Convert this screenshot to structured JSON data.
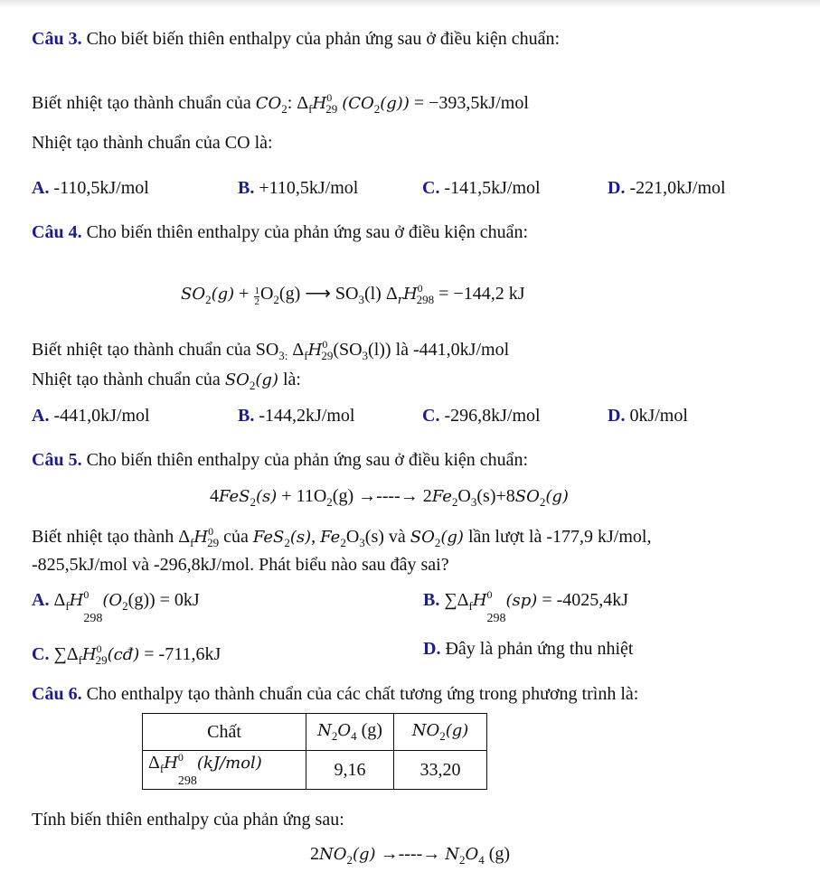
{
  "accent_color": "#1c1c8c",
  "q3": {
    "intro": [
      {
        "t": "Câu 3.",
        "s": "b"
      },
      " Cho biết biến thiên enthalpy của phản ứng sau ở điều kiện chuẩn:"
    ],
    "given": [
      "Biết nhiệt tạo thành chuẩn của ",
      {
        "t": "CO",
        "s": "i"
      },
      {
        "t": "2",
        "s": "sub"
      },
      ": Δ",
      {
        "t": "f",
        "s": "sub"
      },
      {
        "t": "H",
        "s": "i"
      },
      {
        "t": "0",
        "s": "sup"
      },
      {
        "t": "29",
        "s": "sub2"
      },
      " ",
      {
        "t": "(CO",
        "s": "i"
      },
      {
        "t": "2",
        "s": "sub"
      },
      {
        "t": "(g))",
        "s": "i"
      },
      " = −393,5kJ/mol"
    ],
    "question": [
      "Nhiệt tạo thành chuẩn của CO là:"
    ],
    "options": [
      [
        {
          "t": "A.",
          "s": "b"
        },
        " -110,5kJ/mol"
      ],
      [
        {
          "t": "B.",
          "s": "b"
        },
        " +110,5kJ/mol"
      ],
      [
        {
          "t": "C.",
          "s": "b"
        },
        " -141,5kJ/mol"
      ],
      [
        {
          "t": "D.",
          "s": "b"
        },
        " -221,0kJ/mol"
      ]
    ]
  },
  "q4": {
    "intro": [
      {
        "t": "Câu 4.",
        "s": "b"
      },
      " Cho biến thiên enthalpy của phản ứng sau ở điều kiện chuẩn:"
    ],
    "equation": [
      {
        "t": "SO",
        "s": "i"
      },
      {
        "t": "2",
        "s": "sub"
      },
      {
        "t": "(g)",
        "s": "i"
      },
      " + ",
      {
        "t": "1|2",
        "s": "frac"
      },
      "O",
      {
        "t": "2",
        "s": "sub"
      },
      "(g) ⟶ SO",
      {
        "t": "3",
        "s": "sub"
      },
      "(l)  Δ",
      {
        "t": "r",
        "s": "subi"
      },
      {
        "t": "H",
        "s": "i"
      },
      {
        "t": "0",
        "s": "sup"
      },
      {
        "t": "298",
        "s": "sub2"
      },
      " = −144,2 kJ"
    ],
    "given": [
      "Biết nhiệt tạo thành chuẩn của SO",
      {
        "t": "3:",
        "s": "sub"
      },
      " Δ",
      {
        "t": "f",
        "s": "sub"
      },
      {
        "t": "H",
        "s": "i"
      },
      {
        "t": "0",
        "s": "sup"
      },
      {
        "t": "29",
        "s": "sub2"
      },
      "(SO",
      {
        "t": "3",
        "s": "sub"
      },
      "(l)) là -441,0kJ/mol"
    ],
    "question": [
      "Nhiệt tạo thành chuẩn của ",
      {
        "t": "SO",
        "s": "i"
      },
      {
        "t": "2",
        "s": "sub"
      },
      {
        "t": "(g)",
        "s": "i"
      },
      " là:"
    ],
    "options": [
      [
        {
          "t": "A.",
          "s": "b"
        },
        " -441,0kJ/mol"
      ],
      [
        {
          "t": "B.",
          "s": "b"
        },
        " -144,2kJ/mol"
      ],
      [
        {
          "t": "C.",
          "s": "b"
        },
        " -296,8kJ/mol"
      ],
      [
        {
          "t": "D.",
          "s": "b"
        },
        " 0kJ/mol"
      ]
    ]
  },
  "q5": {
    "intro": [
      {
        "t": "Câu 5.",
        "s": "b"
      },
      " Cho biến thiên enthalpy của phản ứng sau ở điều kiện chuẩn:"
    ],
    "equation": [
      "4",
      {
        "t": "FeS",
        "s": "i"
      },
      {
        "t": "2",
        "s": "sub"
      },
      {
        "t": "(s)",
        "s": "i"
      },
      "  +  11O",
      {
        "t": "2",
        "s": "sub"
      },
      "(g)  →----→  2",
      {
        "t": "Fe",
        "s": "i"
      },
      {
        "t": "2",
        "s": "sub"
      },
      "O",
      {
        "t": "3",
        "s": "sub"
      },
      "(s)+8",
      {
        "t": "SO",
        "s": "i"
      },
      {
        "t": "2",
        "s": "sub"
      },
      {
        "t": "(g)",
        "s": "i"
      }
    ],
    "given1": [
      "Biết nhiệt tạo thành Δ",
      {
        "t": "f",
        "s": "sub"
      },
      {
        "t": "H",
        "s": "i"
      },
      {
        "t": "0",
        "s": "sup"
      },
      {
        "t": "29",
        "s": "sub2"
      },
      "  của ",
      {
        "t": "FeS",
        "s": "i"
      },
      {
        "t": "2",
        "s": "sub"
      },
      {
        "t": "(s)",
        "s": "i"
      },
      ", ",
      {
        "t": "Fe",
        "s": "i"
      },
      {
        "t": "2",
        "s": "sub"
      },
      "O",
      {
        "t": "3",
        "s": "sub"
      },
      "(s) và ",
      {
        "t": "SO",
        "s": "i"
      },
      {
        "t": "2",
        "s": "sub"
      },
      {
        "t": "(g)",
        "s": "i"
      },
      " lần lượt là -177,9 kJ/mol,"
    ],
    "given2": [
      "-825,5kJ/mol và -296,8kJ/mol. Phát biểu nào sau đây sai?"
    ],
    "options": [
      [
        {
          "t": "A.",
          "s": "b"
        },
        " Δ",
        {
          "t": "f",
          "s": "sub"
        },
        {
          "t": "H",
          "s": "i"
        },
        {
          "t": "0",
          "s": "sup"
        },
        {
          "t": "298",
          "s": "low"
        },
        {
          "t": "(O",
          "s": "i"
        },
        {
          "t": "2",
          "s": "sub"
        },
        "(g)) = 0kJ"
      ],
      [
        {
          "t": "B.",
          "s": "b"
        },
        " ∑Δ",
        {
          "t": "f",
          "s": "sub"
        },
        {
          "t": "H",
          "s": "i"
        },
        {
          "t": "0",
          "s": "sup"
        },
        {
          "t": "298",
          "s": "low"
        },
        {
          "t": "(sp)",
          "s": "i"
        },
        " = -4025,4kJ"
      ],
      [
        {
          "t": "C.",
          "s": "b"
        },
        " ∑Δ",
        {
          "t": "f",
          "s": "sub"
        },
        {
          "t": "H",
          "s": "i"
        },
        {
          "t": "0",
          "s": "sup"
        },
        {
          "t": "29",
          "s": "sub2"
        },
        {
          "t": "(cđ)",
          "s": "i"
        },
        " = -711,6kJ"
      ],
      [
        {
          "t": "D.",
          "s": "b"
        },
        " Đây là phản ứng thu nhiệt"
      ]
    ]
  },
  "q6": {
    "intro": [
      {
        "t": "Câu 6.",
        "s": "b"
      },
      " Cho enthalpy tạo thành chuẩn của các chất tương ứng trong phương trình là:"
    ],
    "table": {
      "header": [
        [
          "Chất"
        ],
        [
          {
            "t": "N",
            "s": "i"
          },
          {
            "t": "2",
            "s": "sub"
          },
          {
            "t": "O",
            "s": "i"
          },
          {
            "t": "4",
            "s": "sub"
          },
          " (g)"
        ],
        [
          {
            "t": "NO",
            "s": "i"
          },
          {
            "t": "2",
            "s": "sub"
          },
          {
            "t": "(g)",
            "s": "i"
          }
        ]
      ],
      "row": [
        [
          "Δ",
          {
            "t": "f",
            "s": "sub"
          },
          {
            "t": "H",
            "s": "i"
          },
          {
            "t": "0",
            "s": "sup"
          },
          {
            "t": "298",
            "s": "low"
          },
          {
            "t": "(kJ/mol)",
            "s": "i"
          }
        ],
        [
          "9,16"
        ],
        [
          "33,20"
        ]
      ]
    },
    "question": [
      "Tính biến thiên enthalpy của phản ứng sau:"
    ],
    "equation": [
      "2",
      {
        "t": "NO",
        "s": "i"
      },
      {
        "t": "2",
        "s": "sub"
      },
      {
        "t": "(g)",
        "s": "i"
      },
      " →----→ ",
      {
        "t": "N",
        "s": "i"
      },
      {
        "t": "2",
        "s": "sub"
      },
      {
        "t": "O",
        "s": "i"
      },
      {
        "t": "4",
        "s": "sub"
      },
      " (g)"
    ]
  }
}
